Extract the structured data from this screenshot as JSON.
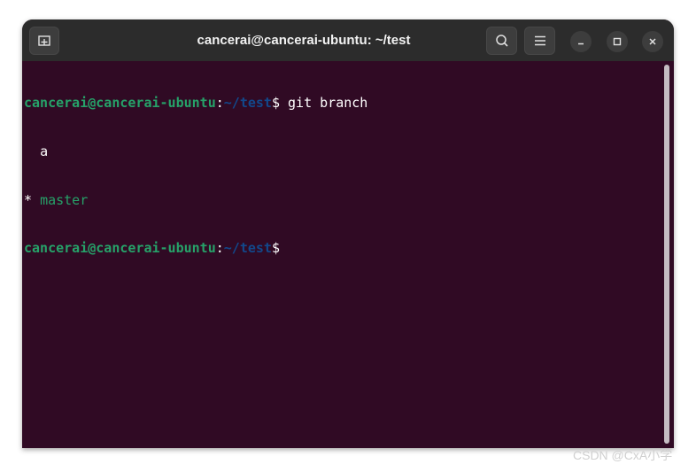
{
  "window": {
    "title": "cancerai@cancerai-ubuntu: ~/test"
  },
  "titlebar_icons": {
    "new_tab": "new-tab-icon",
    "search": "search-icon",
    "menu": "hamburger-menu-icon",
    "minimize": "minimize-icon",
    "maximize": "maximize-icon",
    "close": "close-icon"
  },
  "terminal": {
    "prompt_user_host": "cancerai@cancerai-ubuntu",
    "prompt_colon": ":",
    "prompt_path": "~/test",
    "prompt_dollar": "$",
    "command": " git branch",
    "branch_lines": [
      {
        "marker": "  ",
        "name": "a"
      },
      {
        "marker": "* ",
        "name": "master"
      }
    ]
  },
  "colors": {
    "terminal_background": "#300a24",
    "prompt_user": "#26a269",
    "prompt_path": "#12488b",
    "current_branch": "#26a269",
    "titlebar": "#2c2c2c"
  },
  "watermark": "CSDN @CxA小学"
}
